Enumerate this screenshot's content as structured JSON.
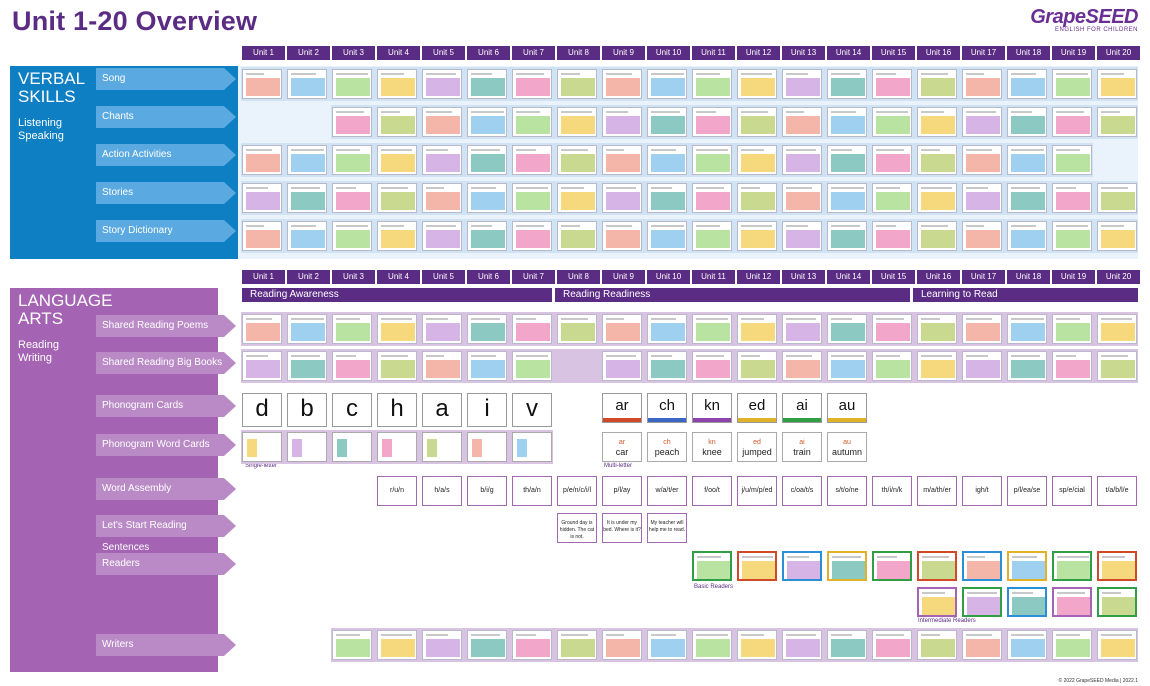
{
  "title": "Unit 1-20 Overview",
  "logo": {
    "name": "GrapeSEED",
    "tagline": "ENGLISH FOR CHILDREN"
  },
  "units": [
    "Unit 1",
    "Unit 2",
    "Unit 3",
    "Unit 4",
    "Unit 5",
    "Unit 6",
    "Unit 7",
    "Unit 8",
    "Unit 9",
    "Unit 10",
    "Unit 11",
    "Unit 12",
    "Unit 13",
    "Unit 14",
    "Unit 15",
    "Unit 16",
    "Unit 17",
    "Unit 18",
    "Unit 19",
    "Unit 20"
  ],
  "units_second": [
    "Unit 1",
    "Unit 2",
    "Unit 3",
    "Unit 4",
    "Unit 5",
    "Unit 6",
    "Unit 7",
    "Unit 8",
    "Unit 9",
    "Unit 10",
    "Unit 11",
    "Unit 12",
    "Unit 13",
    "Unit 14",
    "Unit 15",
    "Unit 16",
    "Unit 17",
    "Unit 18",
    "Unit 19",
    "Unit 20"
  ],
  "verbal": {
    "title_line1": "VERBAL",
    "title_line2": "SKILLS",
    "sub_line1": "Listening",
    "sub_line2": "Speaking",
    "rows": [
      "Song",
      "Chants",
      "Action Activities",
      "Stories",
      "Story Dictionary"
    ]
  },
  "language": {
    "title_line1": "LANGUAGE",
    "title_line2": "ARTS",
    "sub_line1": "Reading",
    "sub_line2": "Writing",
    "rows": [
      "Shared Reading Poems",
      "Shared Reading Big Books",
      "Phonogram Cards",
      "Phonogram Word Cards",
      "Word Assembly",
      "Let's Start Reading Sentences",
      "Readers",
      "Writers"
    ],
    "phases": [
      "Reading Awareness",
      "Reading Readiness",
      "Learning to Read"
    ]
  },
  "phonograms_single": [
    "d",
    "b",
    "c",
    "h",
    "a",
    "i",
    "v"
  ],
  "phonograms_multi": [
    "ar",
    "ch",
    "kn",
    "ed",
    "ai",
    "au"
  ],
  "multi_words": [
    {
      "top": "ar",
      "word": "car"
    },
    {
      "top": "ch",
      "word": "peach"
    },
    {
      "top": "kn",
      "word": "knee"
    },
    {
      "top": "ed",
      "word": "jumped"
    },
    {
      "top": "ai",
      "word": "train"
    },
    {
      "top": "au",
      "word": "autumn"
    }
  ],
  "phono_bar_colors": [
    "#d04a2a",
    "#3a67c4",
    "#8e44ad",
    "#e0b22a",
    "#2f9e44",
    "#e0b22a"
  ],
  "word_assembly": [
    "r/u/n",
    "h/a/s",
    "b/i/g",
    "th/a/n",
    "p/e/n/c/i/l",
    "p/l/ay",
    "w/a/t/er",
    "f/oo/t",
    "j/u/m/p/ed",
    "c/oa/t/s",
    "s/t/o/ne",
    "th/i/n/k",
    "m/a/th/er",
    "igh/t",
    "p/l/ea/se",
    "sp/e/cial",
    "t/a/b/l/e"
  ],
  "sentences": [
    "Ground day is hidden. The cat is not.",
    "It is under my bed. Where is it?",
    "My teacher will help me to read."
  ],
  "captions": {
    "single": "Single-letter",
    "multi": "Multi-letter",
    "basic": "Basic Readers",
    "intermediate": "Intermediate Readers"
  },
  "footer": "© 2022 GrapeSEED Media  |  2022.1",
  "colors": {
    "purple": "#5b2c83",
    "blue": "#0f7fc4",
    "lavender": "#a463b3"
  }
}
